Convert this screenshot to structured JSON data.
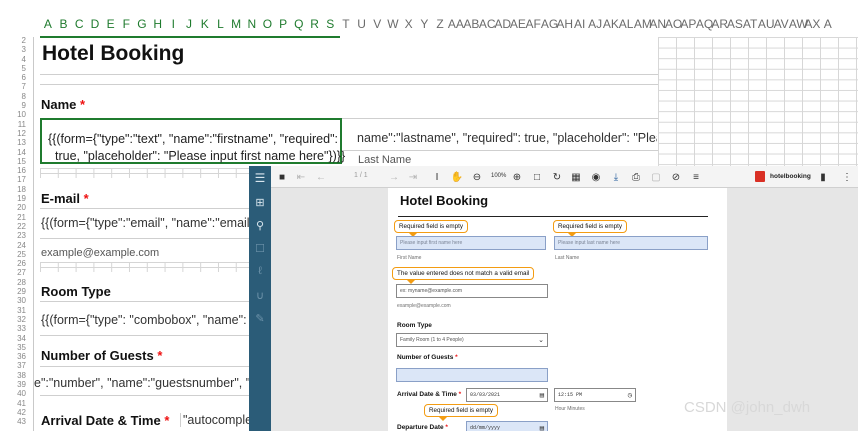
{
  "sheet": {
    "columns": [
      "A",
      "B",
      "C",
      "D",
      "E",
      "F",
      "G",
      "H",
      "I",
      "J",
      "K",
      "L",
      "M",
      "N",
      "O",
      "P",
      "Q",
      "R",
      "S",
      "T",
      "U",
      "V",
      "W",
      "X",
      "Y",
      "Z",
      "AA",
      "AB",
      "AC",
      "AD",
      "AE",
      "AF",
      "AG",
      "AH",
      "AI",
      "AJ",
      "AK",
      "AL",
      "AM",
      "AN",
      "AO",
      "AP",
      "AQ",
      "AR",
      "AS",
      "AT",
      "AU",
      "AV",
      "AW",
      "AX",
      "A"
    ],
    "selected_columns_through": "S",
    "row_numbers": [
      "2",
      "3",
      "4",
      "5",
      "6",
      "7",
      "8",
      "9",
      "10",
      "11",
      "12",
      "13",
      "14",
      "15",
      "16",
      "17",
      "18",
      "19",
      "20",
      "21",
      "22",
      "23",
      "24",
      "25",
      "26",
      "27",
      "28",
      "29",
      "30",
      "31",
      "32",
      "33",
      "34",
      "35",
      "36",
      "37",
      "38",
      "39",
      "40",
      "41",
      "42",
      "43"
    ],
    "title": "Hotel Booking",
    "name_label": "Name",
    "firstname_formula_line1": "{{(form={\"type\":\"text\", \"name\":\"firstname\", \"required\":",
    "firstname_formula_line2": "true, \"placeholder\": \"Please input first name here\"})}}",
    "lastname_formula": "name\":\"lastname\", \"required\": true, \"placeholder\": \"Please",
    "last_name_caption": "Last Name",
    "email_label": "E-mail",
    "email_formula": "{{(form={\"type\":\"email\", \"name\":\"email\"",
    "email_example": "example@example.com",
    "room_type_label": "Room Type",
    "room_type_formula": "{{(form={\"type\": \"combobox\", \"name\": \"",
    "guests_label": "Number of Guests",
    "guests_formula": "e\":\"number\", \"name\":\"guestsnumber\", \"",
    "arrival_label": "Arrival Date & Time",
    "arrival_formula": "\"autocomplet",
    "required_mark": "*"
  },
  "viewer": {
    "page_indicator": "1 / 1",
    "zoom": "100%",
    "file_name": "hotelbooking",
    "toolbar_icons": [
      "menu-icon",
      "open-folder-icon",
      "first-page-icon",
      "previous-page-icon",
      "next-page-icon",
      "last-page-icon",
      "text-select-icon",
      "hand-tool-icon",
      "zoom-out-icon",
      "zoom-in-icon",
      "fit-page-icon",
      "rotate-icon",
      "annotate-icon",
      "color-icon",
      "download-icon",
      "print-icon",
      "save-icon",
      "hide-icon",
      "form-icon",
      "pdf-icon",
      "bookmark-icon",
      "more-icon"
    ],
    "rail_icons": [
      "menu-icon",
      "thumbnails-icon",
      "search-icon",
      "bookmark-icon",
      "attachment-icon",
      "layers-icon",
      "signature-icon"
    ],
    "page": {
      "title": "Hotel Booking",
      "tip_first_name": "Required field is empty",
      "tip_last_name": "Required field is empty",
      "first_name_placeholder": "Please input first name here",
      "last_name_placeholder": "Please input last name here",
      "first_name_caption": "First Name",
      "last_name_caption": "Last Name",
      "tip_email": "The value entered does not match a valid email",
      "email_placeholder": "ex: myname@example.com",
      "email_caption": "example@example.com",
      "room_type_label": "Room Type",
      "room_type_value": "Family Room (1 to 4 People)",
      "guests_label": "Number of Guests",
      "arrival_label": "Arrival Date & Time",
      "arrival_date": "03/03/2021",
      "arrival_time": "12:15 PM",
      "time_caption": "Hour Minutes",
      "tip_departure": "Required field is empty",
      "departure_label": "Departure Date",
      "departure_placeholder": "dd/mm/yyyy",
      "required_mark": "*"
    }
  },
  "watermark": "CSDN @john_dwh",
  "colors": {
    "selection_green": "#1f7b2e",
    "required_red": "#e11111",
    "rail_blue": "#2b5c78",
    "tooltip_orange": "#f39c12",
    "field_blue": "#dbe6f7"
  }
}
